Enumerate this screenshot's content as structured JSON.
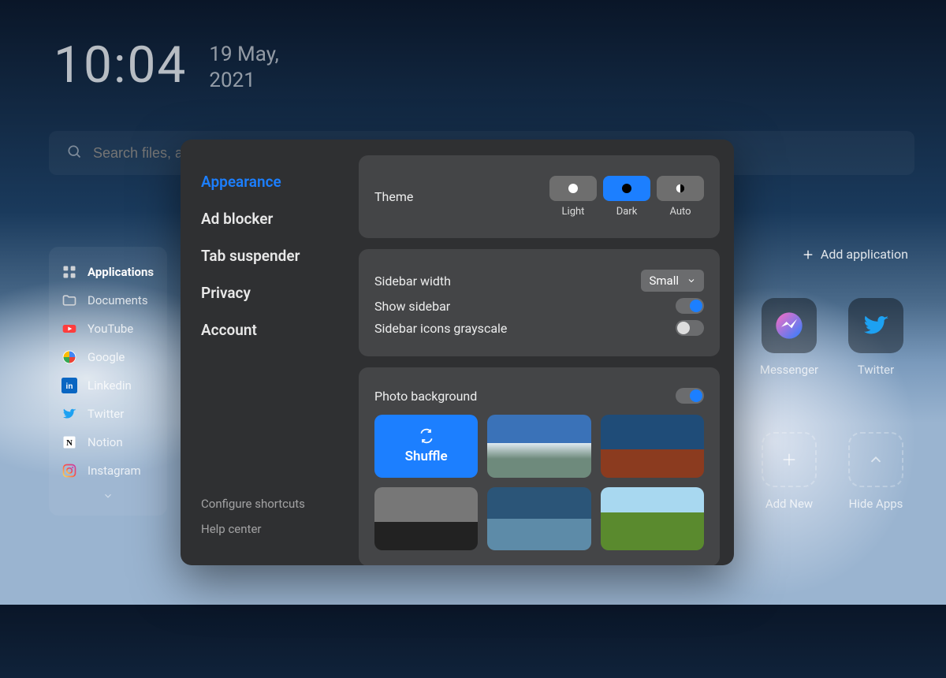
{
  "header": {
    "time": "10:04",
    "date_line1": "19 May,",
    "date_line2": "2021"
  },
  "search": {
    "placeholder": "Search files, apps"
  },
  "sidebar": {
    "items": [
      {
        "label": "Applications",
        "icon": "grid-icon",
        "active": true
      },
      {
        "label": "Documents",
        "icon": "folder-icon"
      },
      {
        "label": "YouTube",
        "icon": "youtube-icon"
      },
      {
        "label": "Google",
        "icon": "google-icon"
      },
      {
        "label": "Linkedin",
        "icon": "linkedin-icon"
      },
      {
        "label": "Twitter",
        "icon": "twitter-icon"
      },
      {
        "label": "Notion",
        "icon": "notion-icon"
      },
      {
        "label": "Instagram",
        "icon": "instagram-icon"
      }
    ]
  },
  "toolbar": {
    "add_application": "Add application"
  },
  "app_tiles": {
    "messenger": "Messenger",
    "twitter": "Twitter",
    "add_new": "Add New",
    "hide_apps": "Hide Apps"
  },
  "settings": {
    "nav": {
      "appearance": "Appearance",
      "ad_blocker": "Ad blocker",
      "tab_suspender": "Tab suspender",
      "privacy": "Privacy",
      "account": "Account",
      "configure": "Configure shortcuts",
      "help": "Help center"
    },
    "theme": {
      "label": "Theme",
      "options": {
        "light": "Light",
        "dark": "Dark",
        "auto": "Auto"
      },
      "selected": "dark"
    },
    "sidebar_width": {
      "label": "Sidebar width",
      "value": "Small"
    },
    "show_sidebar": {
      "label": "Show sidebar",
      "on": true
    },
    "icons_grayscale": {
      "label": "Sidebar icons grayscale",
      "on": false
    },
    "photo_bg": {
      "label": "Photo background",
      "on": true,
      "shuffle": "Shuffle"
    }
  }
}
